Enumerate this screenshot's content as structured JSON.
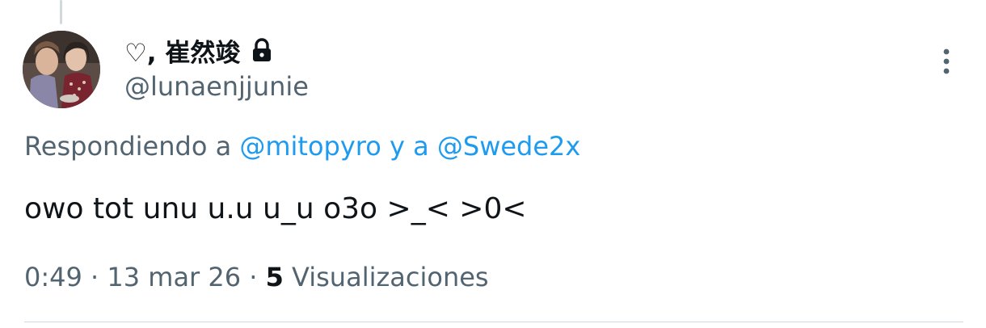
{
  "tweet": {
    "author": {
      "display_name": "♡, 崔然竣",
      "handle": "@lunaenjjunie",
      "protected": true
    },
    "reply_context": {
      "prefix": "Respondiendo a",
      "mention_1": "@mitopyro",
      "joiner": "y a",
      "mention_2": "@Swede2x"
    },
    "text": "owo tot unu u.u u_u o3o >_< >0<",
    "meta": {
      "time": "0:49",
      "separator_1": "·",
      "date": "13 mar 26",
      "separator_2": "·",
      "views_count": "5",
      "views_label": "Visualizaciones"
    }
  },
  "colors": {
    "text_primary": "#0f1419",
    "text_secondary": "#536471",
    "link": "#1d9bf0",
    "divider": "#cfd9de"
  },
  "icons": {
    "lock": "lock-icon",
    "more": "more-vertical-icon"
  }
}
